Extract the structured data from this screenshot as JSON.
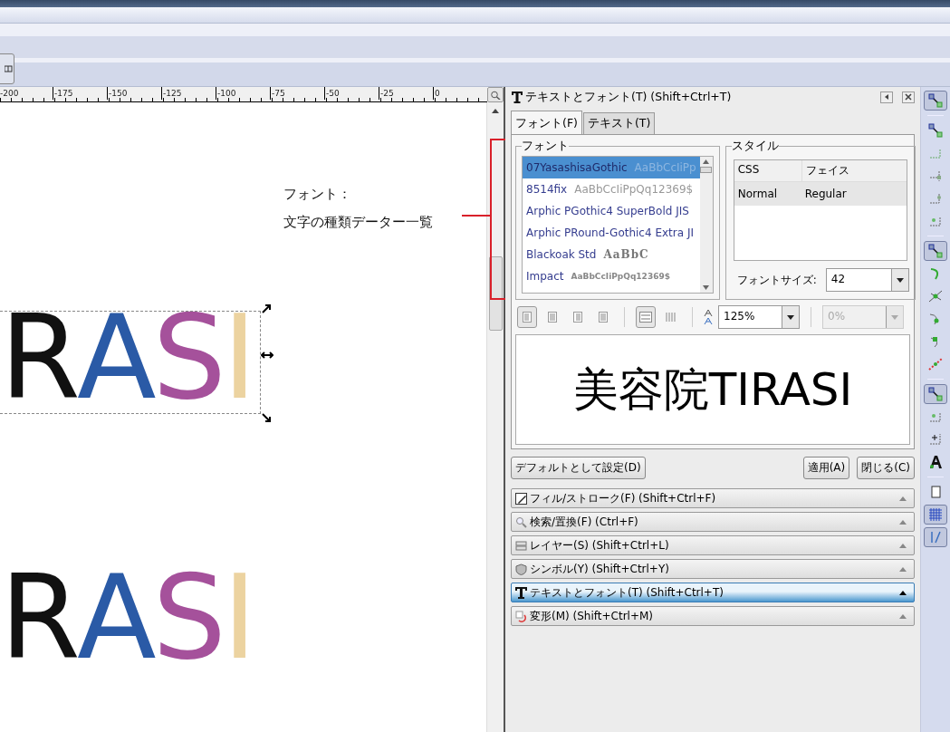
{
  "ruler": {
    "labels": [
      "-200",
      "-175",
      "-150",
      "-125",
      "-100",
      "-75",
      "-50",
      "-25",
      "0"
    ]
  },
  "annotation": {
    "title": "フォント：",
    "text": "文字の種類データー一覧"
  },
  "canvas_texts": [
    {
      "selected": true,
      "letters": [
        {
          "char": "R",
          "color": "#111111"
        },
        {
          "char": "A",
          "color": "#2a5aa6"
        },
        {
          "char": "S",
          "color": "#a5519b"
        },
        {
          "char": "I",
          "color": "#ecd3a0"
        }
      ]
    },
    {
      "selected": false,
      "letters": [
        {
          "char": "R",
          "color": "#111111"
        },
        {
          "char": "A",
          "color": "#2a5aa6"
        },
        {
          "char": "S",
          "color": "#a5519b"
        },
        {
          "char": "I",
          "color": "#ecd3a0"
        }
      ]
    }
  ],
  "dialog": {
    "title": "テキストとフォント(T) (Shift+Ctrl+T)",
    "tabs": [
      {
        "label": "フォント(F)",
        "selected": true
      },
      {
        "label": "テキスト(T)",
        "selected": false
      }
    ],
    "font_frame": {
      "title": "フォント",
      "fonts": [
        {
          "name": "07YasashisaGothic",
          "sample": "AaBbCcIiPp",
          "selected": true
        },
        {
          "name": "8514fix",
          "sample": "AaBbCcIiPpQq12369$",
          "selected": false
        },
        {
          "name": "Arphic PGothic4 SuperBold JIS",
          "selected": false
        },
        {
          "name": "Arphic PRound-Gothic4 Extra JI",
          "selected": false
        },
        {
          "name": "Blackoak Std",
          "sample": "AaBbC",
          "selected": false
        },
        {
          "name": "Impact",
          "sample": "AaBbCcIiPpQq12369$",
          "selected": false
        }
      ]
    },
    "style_frame": {
      "title": "スタイル",
      "columns": [
        "CSS",
        "フェイス"
      ],
      "rows": [
        {
          "css": "Normal",
          "face": "Regular",
          "selected": true
        }
      ],
      "size_label": "フォントサイズ:",
      "size": "42"
    },
    "toolbar": {
      "align": [
        {
          "pressed": true
        },
        {
          "pressed": false
        },
        {
          "pressed": false
        },
        {
          "pressed": false
        }
      ],
      "orientation": [
        {
          "pressed": true
        },
        {
          "pressed": false
        }
      ],
      "line_spacing": "125%",
      "spacing": {
        "value": "0%",
        "disabled": true
      }
    },
    "preview": "美容院TIRASI",
    "buttons": {
      "default": "デフォルトとして設定(D)",
      "apply": "適用(A)",
      "close": "閉じる(C)"
    }
  },
  "dock_items": [
    {
      "kind": "pen",
      "label": "フィル/ストローク(F) (Shift+Ctrl+F)",
      "selected": false
    },
    {
      "kind": "search",
      "label": "検索/置換(F) (Ctrl+F)",
      "selected": false
    },
    {
      "kind": "layers",
      "label": "レイヤー(S) (Shift+Ctrl+L)",
      "selected": false
    },
    {
      "kind": "shield",
      "label": "シンボル(Y) (Shift+Ctrl+Y)",
      "selected": false
    },
    {
      "kind": "text",
      "label": "テキストとフォント(T) (Shift+Ctrl+T)",
      "selected": true
    },
    {
      "kind": "transform",
      "label": "変形(M) (Shift+Ctrl+M)",
      "selected": false
    }
  ],
  "snap_toolbar": [
    {
      "kind": "snap",
      "pressed": true
    },
    {
      "kind": "sep"
    },
    {
      "kind": "snap",
      "pressed": false
    },
    {
      "kind": "edge",
      "pressed": false
    },
    {
      "kind": "corner",
      "pressed": false
    },
    {
      "kind": "midedge",
      "pressed": false
    },
    {
      "kind": "center",
      "pressed": false
    },
    {
      "kind": "sep"
    },
    {
      "kind": "snap",
      "pressed": true
    },
    {
      "kind": "curve",
      "pressed": false
    },
    {
      "kind": "cross",
      "pressed": false
    },
    {
      "kind": "curve2",
      "pressed": false
    },
    {
      "kind": "curve3",
      "pressed": false
    },
    {
      "kind": "dots",
      "pressed": false
    },
    {
      "kind": "sep"
    },
    {
      "kind": "snap",
      "pressed": true
    },
    {
      "kind": "center",
      "pressed": false
    },
    {
      "kind": "plus",
      "pressed": false
    },
    {
      "kind": "letter",
      "pressed": false
    },
    {
      "kind": "sep"
    },
    {
      "kind": "page",
      "pressed": false
    },
    {
      "kind": "grid",
      "pressed": true
    },
    {
      "kind": "guide",
      "pressed": true
    }
  ]
}
